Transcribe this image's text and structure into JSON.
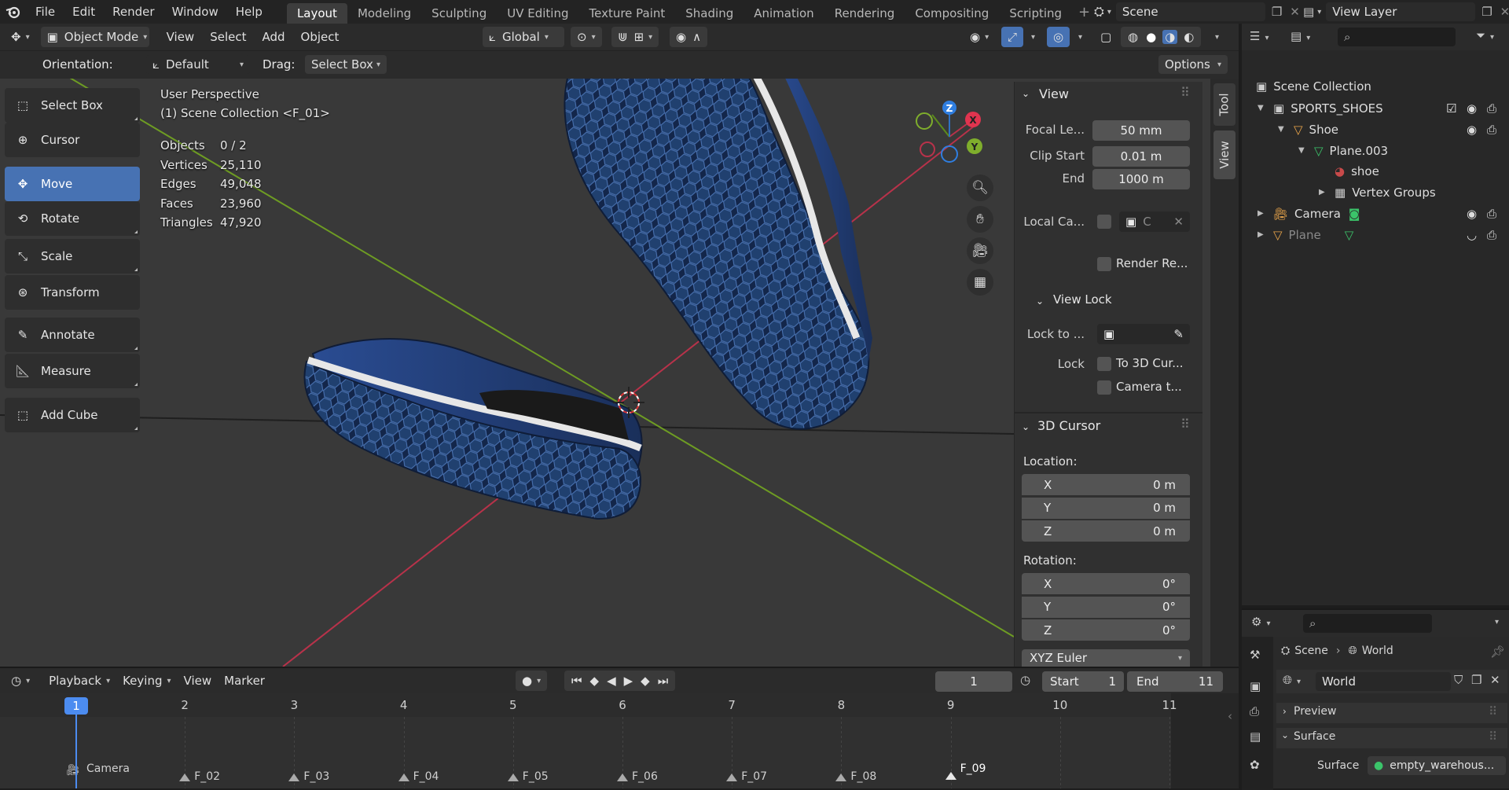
{
  "menu": {
    "file": "File",
    "edit": "Edit",
    "render": "Render",
    "window": "Window",
    "help": "Help"
  },
  "workspaces": [
    "Layout",
    "Modeling",
    "Sculpting",
    "UV Editing",
    "Texture Paint",
    "Shading",
    "Animation",
    "Rendering",
    "Compositing",
    "Scripting"
  ],
  "scene": {
    "name": "Scene"
  },
  "view_layer": {
    "name": "View Layer"
  },
  "header": {
    "mode": "Object Mode",
    "view": "View",
    "select": "Select",
    "add": "Add",
    "object": "Object",
    "transform_orientation": "Global"
  },
  "tool_settings": {
    "orientation_label": "Orientation:",
    "orientation_value": "Default",
    "drag_label": "Drag:",
    "drag_value": "Select Box",
    "options": "Options"
  },
  "toolbar": [
    {
      "label": "Select Box",
      "icon": "select-box-icon",
      "active": false
    },
    {
      "label": "Cursor",
      "icon": "cursor-icon",
      "active": false
    },
    {
      "label": "Move",
      "icon": "move-icon",
      "active": true
    },
    {
      "label": "Rotate",
      "icon": "rotate-icon",
      "active": false
    },
    {
      "label": "Scale",
      "icon": "scale-icon",
      "active": false
    },
    {
      "label": "Transform",
      "icon": "transform-icon",
      "active": false
    },
    {
      "label": "Annotate",
      "icon": "annotate-icon",
      "active": false
    },
    {
      "label": "Measure",
      "icon": "measure-icon",
      "active": false
    },
    {
      "label": "Add Cube",
      "icon": "add-cube-icon",
      "active": false
    }
  ],
  "overlay": {
    "perspective": "User Perspective",
    "collection": "(1) Scene Collection <F_01>",
    "stats": [
      {
        "label": "Objects",
        "value": "0 / 2"
      },
      {
        "label": "Vertices",
        "value": "25,110"
      },
      {
        "label": "Edges",
        "value": "49,048"
      },
      {
        "label": "Faces",
        "value": "23,960"
      },
      {
        "label": "Triangles",
        "value": "47,920"
      }
    ]
  },
  "gizmo": {
    "x": "X",
    "y": "Y",
    "z": "Z"
  },
  "npanel": {
    "view_title": "View",
    "focal_label": "Focal Le...",
    "focal_value": "50 mm",
    "clip_start_label": "Clip Start",
    "clip_start_value": "0.01 m",
    "end_label": "End",
    "end_value": "1000 m",
    "local_camera_label": "Local Ca...",
    "local_camera_value": "C",
    "render_region_label": "Render Re...",
    "view_lock_title": "View Lock",
    "lock_to_label": "Lock to ...",
    "lock_label": "Lock",
    "to_3d_cursor": "To 3D Cur...",
    "camera_to": "Camera t...",
    "cursor_title": "3D Cursor",
    "location_label": "Location:",
    "location": [
      {
        "axis": "X",
        "value": "0 m"
      },
      {
        "axis": "Y",
        "value": "0 m"
      },
      {
        "axis": "Z",
        "value": "0 m"
      }
    ],
    "rotation_label": "Rotation:",
    "rotation": [
      {
        "axis": "X",
        "value": "0°"
      },
      {
        "axis": "Y",
        "value": "0°"
      },
      {
        "axis": "Z",
        "value": "0°"
      }
    ],
    "rotation_mode": "XYZ Euler",
    "tab_tool": "Tool",
    "tab_view": "View"
  },
  "outliner": {
    "root": "Scene Collection",
    "items": [
      {
        "name": "SPORTS_SHOES",
        "indent": 1
      },
      {
        "name": "Shoe",
        "indent": 2
      },
      {
        "name": "Plane.003",
        "indent": 3
      },
      {
        "name": "shoe",
        "indent": 4
      },
      {
        "name": "Vertex Groups",
        "indent": 4
      },
      {
        "name": "Camera",
        "indent": 1
      },
      {
        "name": "Plane",
        "indent": 1
      }
    ]
  },
  "properties": {
    "breadcrumb_scene": "Scene",
    "breadcrumb_world": "World",
    "world_name": "World",
    "preview": "Preview",
    "surface_section": "Surface",
    "surface_label": "Surface",
    "surface_value": "empty_warehous..."
  },
  "timeline": {
    "playback": "Playback",
    "keying": "Keying",
    "view": "View",
    "marker": "Marker",
    "current_frame": "1",
    "start_label": "Start",
    "start_value": "1",
    "end_label": "End",
    "end_value": "11",
    "frames": [
      "1",
      "2",
      "3",
      "4",
      "5",
      "6",
      "7",
      "8",
      "9",
      "10",
      "11"
    ],
    "markers": [
      "Camera",
      "F_02",
      "F_03",
      "F_04",
      "F_05",
      "F_06",
      "F_07",
      "F_08",
      "F_09"
    ]
  }
}
